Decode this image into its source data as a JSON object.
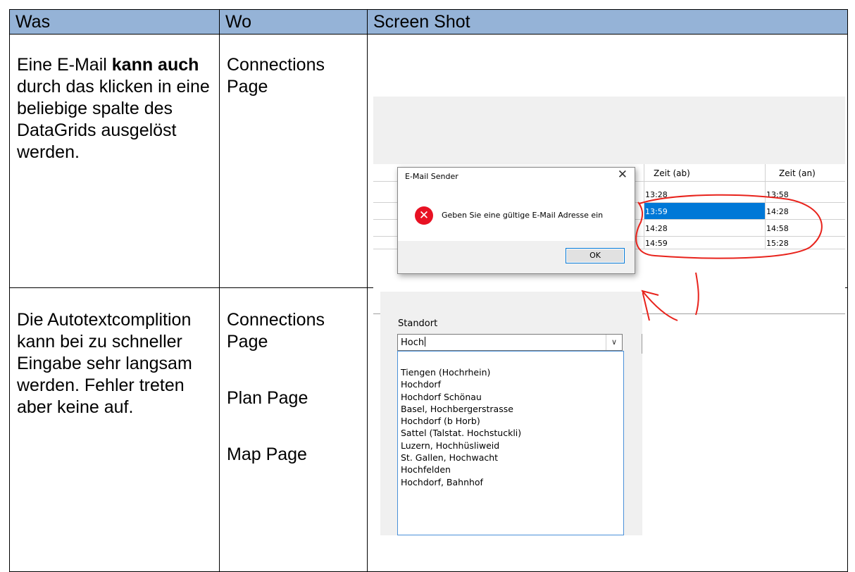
{
  "table": {
    "headers": [
      "Was",
      "Wo",
      "Screen Shot"
    ],
    "rows": [
      {
        "was_parts": [
          "Eine E-Mail ",
          "kann auch",
          " durch das klicken in eine beliebige spalte des DataGrids ausgelöst werden."
        ],
        "wo": [
          "Connections Page"
        ]
      },
      {
        "was_parts": [
          "Die Autotextcomplition kann bei zu schneller Eingabe sehr langsam werden. Fehler treten aber keine auf."
        ],
        "wo": [
          "Connections Page",
          "Plan Page",
          "Map Page"
        ]
      }
    ]
  },
  "shot1": {
    "grid_headers": [
      "Zeit (ab)",
      "Zeit (an)"
    ],
    "rows": [
      [
        "13:28",
        "13:58"
      ],
      [
        "13:59",
        "14:28"
      ],
      [
        "14:28",
        "14:58"
      ],
      [
        "14:59",
        "15:28"
      ]
    ],
    "selected_row": 1,
    "dialog": {
      "title": "E-Mail Sender",
      "close_glyph": "✕",
      "icon_glyph": "✕",
      "message": "Geben Sie eine gültige E-Mail Adresse ein",
      "ok_label": "OK"
    },
    "colors": {
      "selection": "#0078d7",
      "ink": "#e8231c",
      "error_icon": "#e81123"
    }
  },
  "shot2": {
    "label": "Standort",
    "input_value": "Hoch",
    "dropdown_glyph": "∨",
    "suggestions": [
      "Tiengen (Hochrhein)",
      "Hochdorf",
      "Hochdorf Schönau",
      "Basel, Hochbergerstrasse",
      "Hochdorf (b Horb)",
      "Sattel (Talstat. Hochstuckli)",
      "Luzern, Hochhüsliweid",
      "St. Gallen, Hochwacht",
      "Hochfelden",
      "Hochdorf, Bahnhof"
    ]
  },
  "colors": {
    "header_bg": "#95b3d7"
  }
}
